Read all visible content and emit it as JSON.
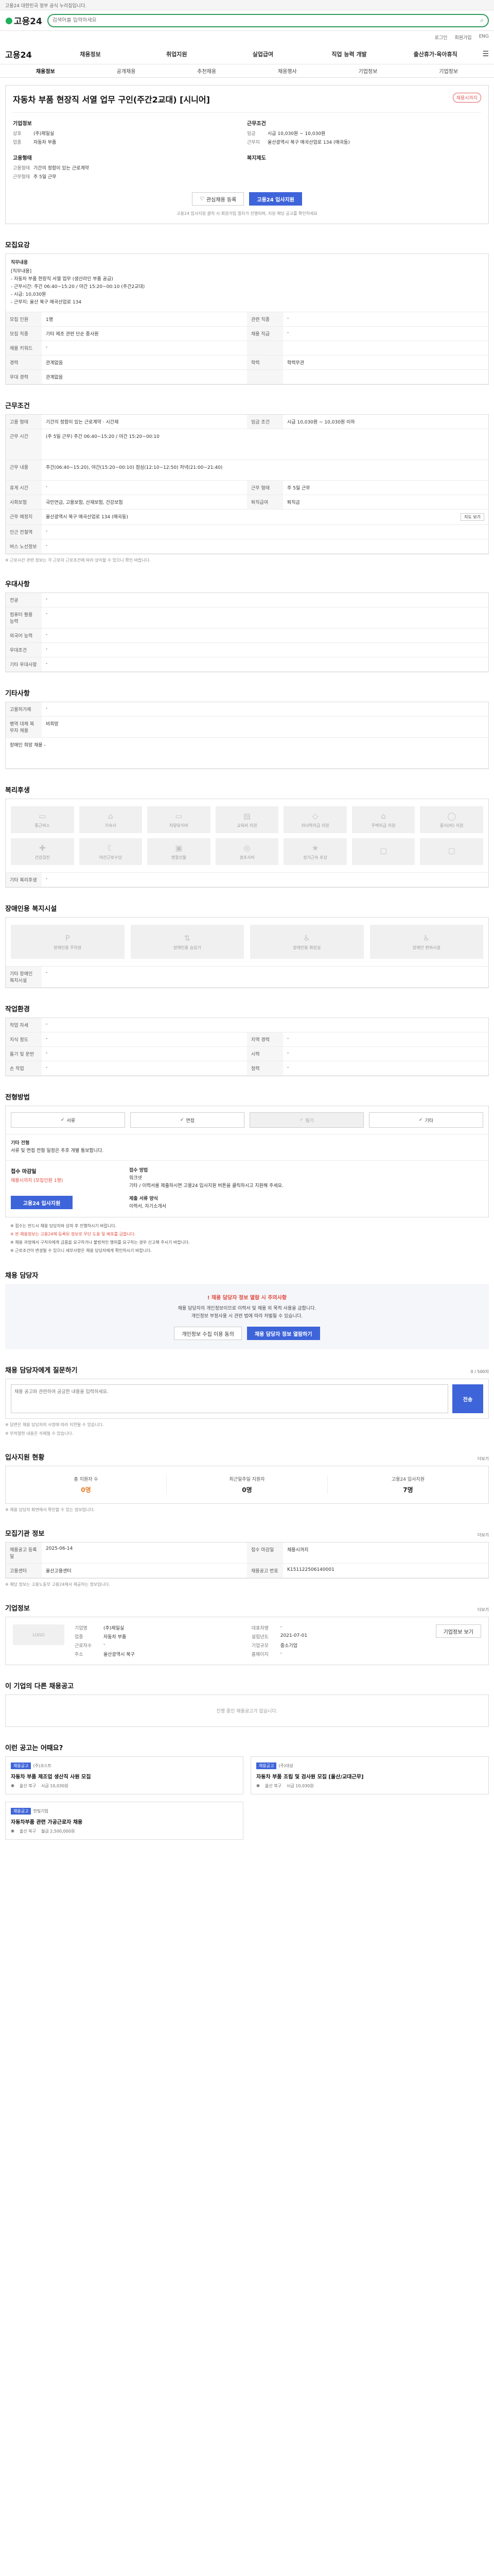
{
  "topbar": {
    "text": "고용24 대한민국 정부 공식 누리집입니다."
  },
  "header": {
    "logo": "고용24",
    "search_placeholder": "검색어를 입력하세요"
  },
  "utilbar": {
    "items": [
      "로그인",
      "회원가입",
      "ENG"
    ]
  },
  "nav": {
    "logo": "고용24",
    "items": [
      "채용정보",
      "취업지원",
      "실업급여",
      "직업 능력 개발",
      "출산휴가·육아휴직"
    ],
    "menu_icon": "hamburger-icon"
  },
  "subnav": {
    "items": [
      "채용정보",
      "공개채용",
      "추천채용",
      "채용행사",
      "기업정보",
      "기업정보"
    ]
  },
  "job": {
    "title": "자동차 부품 현장직 서열 업무 구인(주간2교대) [시니어]",
    "badge": "채용시까지",
    "company_title": "기업정보",
    "company_label1": "상호",
    "company_value1": "(주)제일실",
    "company_label2": "업종",
    "company_value2": "자동차 부품",
    "recruit_title": "고용형태",
    "recruit_label1": "고용형태",
    "recruit_value1": "기간의 정함이 있는 근로계약",
    "recruit_label2": "근무형태",
    "recruit_value2": "주 5일 근무",
    "work_title": "근무조건",
    "work_label1": "임금",
    "work_value1": "시급 10,030원 ~ 10,030원",
    "work_label2": "근무지",
    "work_value2": "울산광역시 북구 매곡산업로 134 (매곡동)",
    "apply_title": "복지제도",
    "save_btn": "관심채용 등록",
    "apply_btn": "고용24 입사지원",
    "note": "고용24 입사지원 클릭 시 회원가입 절차가 진행되며, 지원 해당 공고를 확인하세요"
  },
  "recruit": {
    "section": "모집요강",
    "duty_label": "직무내용",
    "duty_text1": "[직무내용]",
    "duty_text2": "- 자동차 부품 현장직 서열 업무 (생산라인 부품 공급)",
    "duty_text3": "- 근무시간: 주간 06:40~15:20 / 야간 15:20~00:10 (주간2교대)",
    "duty_text4": "- 시급: 10,030원",
    "duty_text5": "- 근무지: 울산 북구 매곡산업로 134",
    "rows": [
      {
        "k1": "모집 인원",
        "v1": "1명",
        "k2": "관련 직종",
        "v2": "-"
      },
      {
        "k1": "모집 직종",
        "v1": "기타 제조 관련 단순 종사원",
        "k2": "채용 직급",
        "v2": "-"
      },
      {
        "k1": "채용 키워드",
        "v1": "-",
        "k2": "",
        "v2": ""
      },
      {
        "k1": "경력",
        "v1": "관계없음",
        "k2": "학력",
        "v2": "학력무관"
      },
      {
        "k1": "우대 경력",
        "v1": "관계없음",
        "k2": "",
        "v2": ""
      }
    ]
  },
  "work": {
    "section": "근무조건",
    "rows": [
      {
        "k1": "고용 형태",
        "v1": "기간의 정함이 있는 근로계약 · 시간제",
        "k2": "임금 조건",
        "v2": "시급 10,030원 ~ 10,030원 이하"
      },
      {
        "k1": "근무 시간",
        "v1": "(주 5일 근무) 주간 06:40~15:20 / 야간 15:20~00:10",
        "k2": "",
        "v2": ""
      },
      {
        "k1": "근무 내용",
        "v1": "주간(06:40~15:20), 야간(15:20~00:10) 점심(12:10~12:50) 저녁(21:00~21:40)",
        "k2": "",
        "v2": ""
      },
      {
        "k1": "휴게 시간",
        "v1": "-",
        "k2": "근무 형태",
        "v2": "주 5일 근무"
      },
      {
        "k1": "사회보험",
        "v1": "국민연금, 고용보험, 산재보험, 건강보험",
        "k2": "퇴직급여",
        "v2": "퇴직금"
      },
      {
        "k1": "근무 예정지",
        "v1": "울산광역시 북구 매곡산업로 134 (매곡동)",
        "k2": "",
        "v2": ""
      },
      {
        "k1": "인근 전철역",
        "v1": "-",
        "k2": "",
        "v2": ""
      },
      {
        "k1": "버스 노선정보",
        "v1": "-",
        "k2": "",
        "v2": ""
      }
    ],
    "map_btn": "지도 보기",
    "note": "※ 근로시간 관련 정보는 각 근로자 근로조건에 따라 상이할 수 있으니 확인 바랍니다."
  },
  "preference": {
    "section": "우대사항",
    "rows": [
      {
        "k": "전공",
        "v": "-"
      },
      {
        "k": "컴퓨터 활용 능력",
        "v": "-"
      },
      {
        "k": "외국어 능력",
        "v": "-"
      },
      {
        "k": "우대조건",
        "v": "-"
      },
      {
        "k": "기타 우대사항",
        "v": "-"
      }
    ]
  },
  "other": {
    "section": "기타사항",
    "rows": [
      {
        "k": "고용허가제",
        "v": "-"
      },
      {
        "k": "병역 대체 복무자 채용",
        "v": "비희망"
      },
      {
        "k": "장애인 희망 채용",
        "v": "-"
      }
    ]
  },
  "welfare": {
    "section": "복리후생",
    "items": [
      "통근버스",
      "기숙사",
      "차량유지비",
      "교육비 지원",
      "자녀학자금 지원",
      "주택자금 지원",
      "중식(비) 지원",
      "건강검진",
      "야간근로수당",
      "명절선물",
      "경조사비",
      "장기근속 포상",
      "",
      ""
    ],
    "other_label": "기타 복리후생",
    "other_value": "-"
  },
  "disabled": {
    "section": "장애인용 복지시설",
    "items": [
      "장애인용 주차장",
      "장애인용 승강기",
      "장애인용 화장실",
      "장애인 편의시설"
    ],
    "other_label": "기타 장애인 복지시설",
    "other_value": "-"
  },
  "env": {
    "section": "작업환경",
    "rows": [
      {
        "k1": "작업 자세",
        "v1": "-",
        "k2": "",
        "v2": ""
      },
      {
        "k1": "지식 정도",
        "v1": "-",
        "k2": "지역 경력",
        "v2": "-"
      },
      {
        "k1": "들기 및 운반",
        "v1": "-",
        "k2": "시력",
        "v2": "-"
      },
      {
        "k1": "손 작업",
        "v1": "-",
        "k2": "청력",
        "v2": "-"
      }
    ]
  },
  "method": {
    "section": "전형방법",
    "options": [
      "서류",
      "면접",
      "필기",
      "기타"
    ],
    "label": "기타 전형",
    "text1": "서류 및 면접 전형 일정은 추후 개별 통보합니다.",
    "deadline_label": "접수 마감일",
    "deadline_date": "채용시까지 (모집인원 1명)",
    "apply_btn": "고용24 입사지원",
    "apply_method_label": "접수 방법",
    "apply_method1": "워크넷",
    "apply_method2": "기타 / 이력서를 제출하시면 고용24 입사지원 버튼을 클릭하시고 지원해 주세요.",
    "submit_label": "제출 서류 양식",
    "submit_value": "이력서, 자기소개서"
  },
  "warnings": [
    "※ 접수는 반드시 채용 담당자와 상의 후 진행하시기 바랍니다.",
    "※ 본 채용정보는 고용24에 등록된 정보로 무단 도용 및 배포를 금합니다.",
    "※ 채용 과정에서 구직자에게 금품을 요구하거나 불법적인 행위를 요구하는 경우 신고해 주시기 바랍니다.",
    "※ 근로조건이 변경될 수 있으니 세부사항은 채용 담당자에게 확인하시기 바랍니다."
  ],
  "contact": {
    "section": "채용 담당자",
    "notice_title": "채용 담당자 정보 열람 시 주의사항",
    "notice_text1": "채용 담당자의 개인정보이므로 이력서 및 채용 외 목적 사용을 금합니다.",
    "notice_text2": "개인정보 부정사용 시 관련 법에 따라 처벌될 수 있습니다.",
    "btn1": "개인정보 수집 이용 동의",
    "btn2": "채용 담당자 정보 열람하기"
  },
  "inquiry": {
    "section": "채용 담당자에게 질문하기",
    "count": "0 / 500자",
    "placeholder": "채용 공고와 관련하여 궁금한 내용을 입력하세요.",
    "send_btn": "전송",
    "note1": "※ 답변은 채용 담당자의 사정에 따라 지연될 수 있습니다.",
    "note2": "※ 부적절한 내용은 삭제될 수 있습니다."
  },
  "stats": {
    "section": "입사지원 현황",
    "more": "더보기",
    "items": [
      {
        "label": "총 지원자 수",
        "value": "0명"
      },
      {
        "label": "최근일주일 지원자",
        "value": "0명"
      },
      {
        "label": "고용24 입사지원",
        "value": "7명"
      }
    ],
    "note": "※ 채용 담당자 화면에서 확인할 수 있는 정보입니다."
  },
  "info": {
    "section": "모집기관 정보",
    "more": "더보기",
    "rows": [
      {
        "k1": "채용공고 등록일",
        "v1": "2025-06-14",
        "k2": "접수 마감일",
        "v2": "채용시까지"
      },
      {
        "k1": "고용센터",
        "v1": "울산고용센터",
        "k2": "채용공고 번호",
        "v2": "K151122506140001"
      }
    ],
    "note": "※ 해당 정보는 고용노동부 고용24에서 제공하는 정보입니다."
  },
  "company": {
    "section": "기업정보",
    "more": "더보기",
    "logo_text": "LOGO",
    "labels": [
      "기업명",
      "대표자명",
      "업종",
      "설립년도",
      "근로자수",
      "기업규모",
      "주소",
      "홈페이지"
    ],
    "values": [
      "(주)제일실",
      "-",
      "자동차 부품",
      "2021-07-01",
      "-",
      "중소기업",
      "울산광역시 북구",
      "-"
    ],
    "btn": "기업정보 보기"
  },
  "similar": {
    "section": "이 기업의 다른 채용공고",
    "empty": "진행 중인 채용공고가 없습니다."
  },
  "recommend": {
    "section": "이런 공고는 어때요?",
    "cards": [
      {
        "tag": "채용공고",
        "company": "(주)코스트",
        "title": "자동차 부품 제조업 생산직 사원 모집",
        "loc": "울산 북구",
        "pay": "시급 10,030원"
      },
      {
        "tag": "채용공고",
        "company": "(주)대성",
        "title": "자동차 부품 조립 및 검사원 모집 [울산/교대근무]",
        "loc": "울산 북구",
        "pay": "시급 10,030원"
      },
      {
        "tag": "채용공고",
        "company": "한빛기업",
        "title": "자동차부품 관련 가공근로자 채용",
        "loc": "울산 북구",
        "pay": "월급 2,500,000원"
      }
    ]
  }
}
